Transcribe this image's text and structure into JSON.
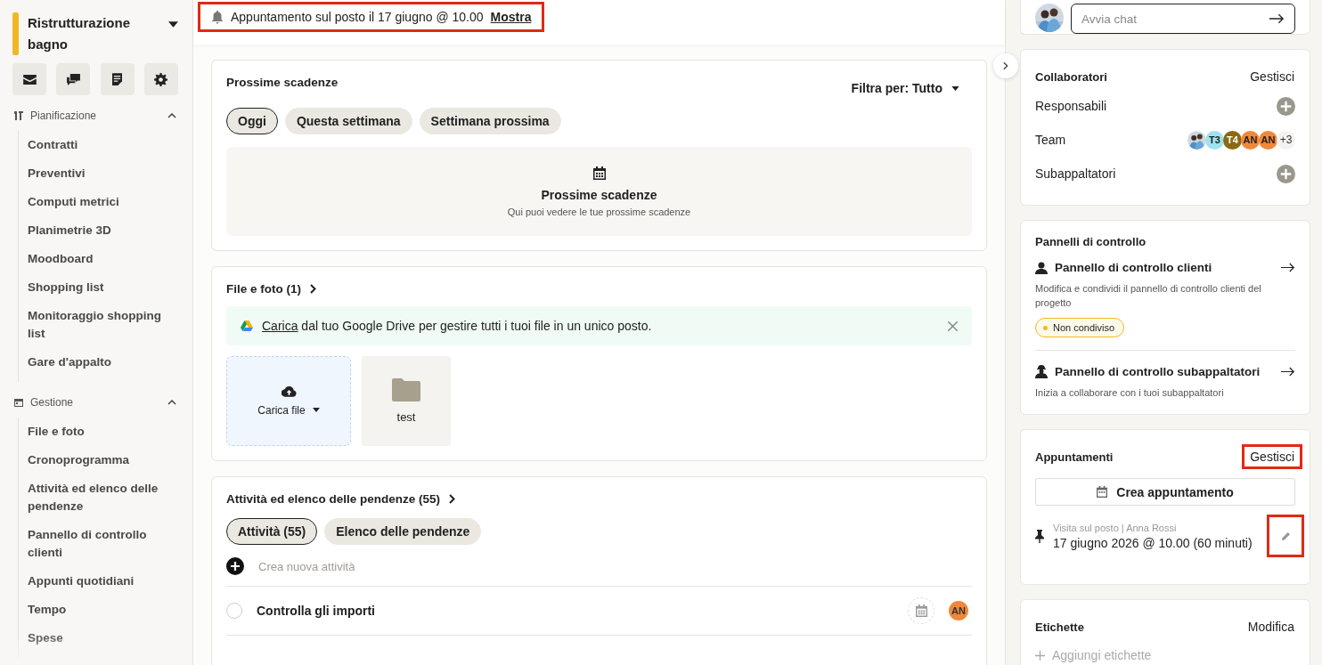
{
  "sidebar": {
    "project": "Ristrutturazione bagno",
    "sections": [
      {
        "title": "Pianificazione",
        "expanded": true,
        "items": [
          "Contratti",
          "Preventivi",
          "Computi metrici",
          "Planimetrie 3D",
          "Moodboard",
          "Shopping list",
          "Monitoraggio shopping list",
          "Gare d'appalto"
        ]
      },
      {
        "title": "Gestione",
        "expanded": true,
        "items": [
          "File e foto",
          "Cronoprogramma",
          "Attività ed elenco delle pendenze",
          "Pannello di controllo clienti",
          "Appunti quotidiani",
          "Tempo",
          "Spese"
        ]
      }
    ]
  },
  "notification": {
    "text": "Appuntamento sul posto il 17 giugno @ 10.00",
    "link": "Mostra",
    "highlighted": true
  },
  "deadlines": {
    "title": "Prossime scadenze",
    "filter": "Filtra per: Tutto",
    "chips": [
      {
        "label": "Oggi",
        "selected": true
      },
      {
        "label": "Questa settimana",
        "selected": false
      },
      {
        "label": "Settimana prossima",
        "selected": false
      }
    ],
    "empty_title": "Prossime scadenze",
    "empty_subtitle": "Qui puoi vedere le tue prossime scadenze"
  },
  "files": {
    "title": "File e foto (1)",
    "banner_link": "Carica",
    "banner_text": "dal tuo Google Drive per gestire tutti i tuoi file in un unico posto.",
    "upload": "Carica file",
    "folders": [
      {
        "name": "test"
      }
    ]
  },
  "tasks": {
    "title": "Attività ed elenco delle pendenze (55)",
    "chips": [
      {
        "label": "Attività (55)",
        "selected": true
      },
      {
        "label": "Elenco delle pendenze",
        "selected": false
      }
    ],
    "new_task": "Crea nuova attività",
    "rows": [
      {
        "title": "Controlla gli importi",
        "checked": false,
        "assignee": "AN",
        "color": "#f0883a"
      }
    ]
  },
  "chat": {
    "placeholder": "Avvia chat"
  },
  "collaborators": {
    "title": "Collaboratori",
    "action": "Gestisci",
    "rows": [
      {
        "label": "Responsabili",
        "kind": "add"
      },
      {
        "label": "Team",
        "kind": "avatars",
        "avatars": [
          {
            "kind": "picture"
          },
          {
            "initials": "T3",
            "color": "#9ee3ee"
          },
          {
            "initials": "T4",
            "color": "#8c6a12"
          },
          {
            "initials": "AN",
            "color": "#f0883a"
          },
          {
            "initials": "AN",
            "color": "#f0883a"
          }
        ],
        "more": "+3"
      },
      {
        "label": "Subappaltatori",
        "kind": "add"
      }
    ]
  },
  "dashboards": {
    "title": "Pannelli di controllo",
    "items": [
      {
        "title": "Pannello di controllo clienti",
        "description": "Modifica e condividi il pannello di controllo clienti del progetto",
        "badge": "Non condiviso",
        "color": "#f2b824"
      },
      {
        "title": "Pannello di controllo subappaltatori",
        "description": "Inizia a collaborare con i tuoi subappaltatori"
      }
    ]
  },
  "appointments": {
    "title": "Appuntamenti",
    "action": "Gestisci",
    "action_highlighted": true,
    "create": "Crea appuntamento",
    "items": [
      {
        "meta": "Visita sul posto | Anna Rossi",
        "when": "17 giugno 2026 @ 10.00 (60 minuti)",
        "edit_highlighted": true
      }
    ]
  },
  "labels": {
    "title": "Etichette",
    "action": "Modifica",
    "add": "Aggiungi etichette"
  }
}
